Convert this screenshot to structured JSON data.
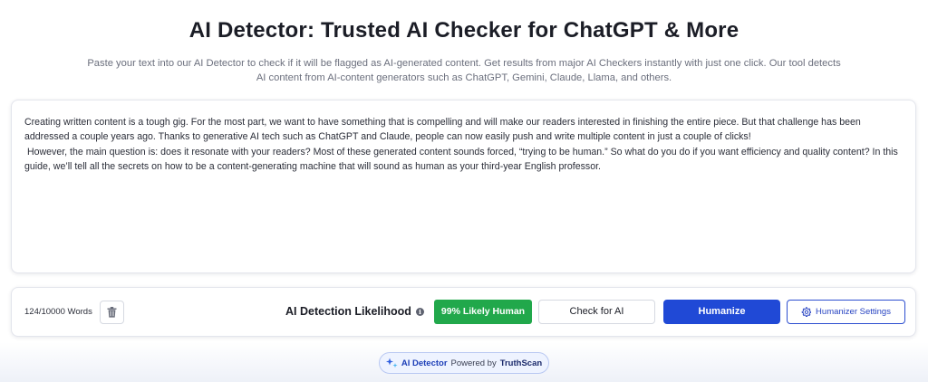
{
  "header": {
    "title": "AI Detector: Trusted AI Checker for ChatGPT & More",
    "subtitle": "Paste your text into our AI Detector to check if it will be flagged as AI-generated content. Get results from major AI Checkers instantly with just one click. Our tool detects AI content from AI-content generators such as ChatGPT, Gemini, Claude, Llama, and others."
  },
  "editor": {
    "paragraphs": [
      "Creating written content is a tough gig. For the most part, we want to have something that is compelling and will make our readers interested in finishing the entire piece. But that challenge has been addressed a couple years ago. Thanks to generative AI tech such as ChatGPT and Claude, people can now easily push and write multiple content in just a couple of clicks!",
      " However, the main question is: does it resonate with your readers? Most of these generated content sounds forced, “trying to be human.” So what do you do if you want efficiency and quality content? In this guide, we’ll tell all the secrets on how to be a content-generating machine that will sound as human as your third-year English professor."
    ]
  },
  "toolbar": {
    "word_count": "124/10000 Words",
    "clear_icon": "trash-icon",
    "detection_label": "AI Detection Likelihood",
    "info_icon": "info-icon",
    "result_badge": "99% Likely Human",
    "result_color": "#21a84b",
    "check_label": "Check for AI",
    "humanize_label": "Humanize",
    "humanize_color": "#2049d6",
    "settings_icon": "gear-icon",
    "settings_label": "Humanizer Settings"
  },
  "footer": {
    "product_icon": "sparkle-icon",
    "product": "AI Detector",
    "powered_by": "Powered by",
    "brand": "TruthScan"
  }
}
